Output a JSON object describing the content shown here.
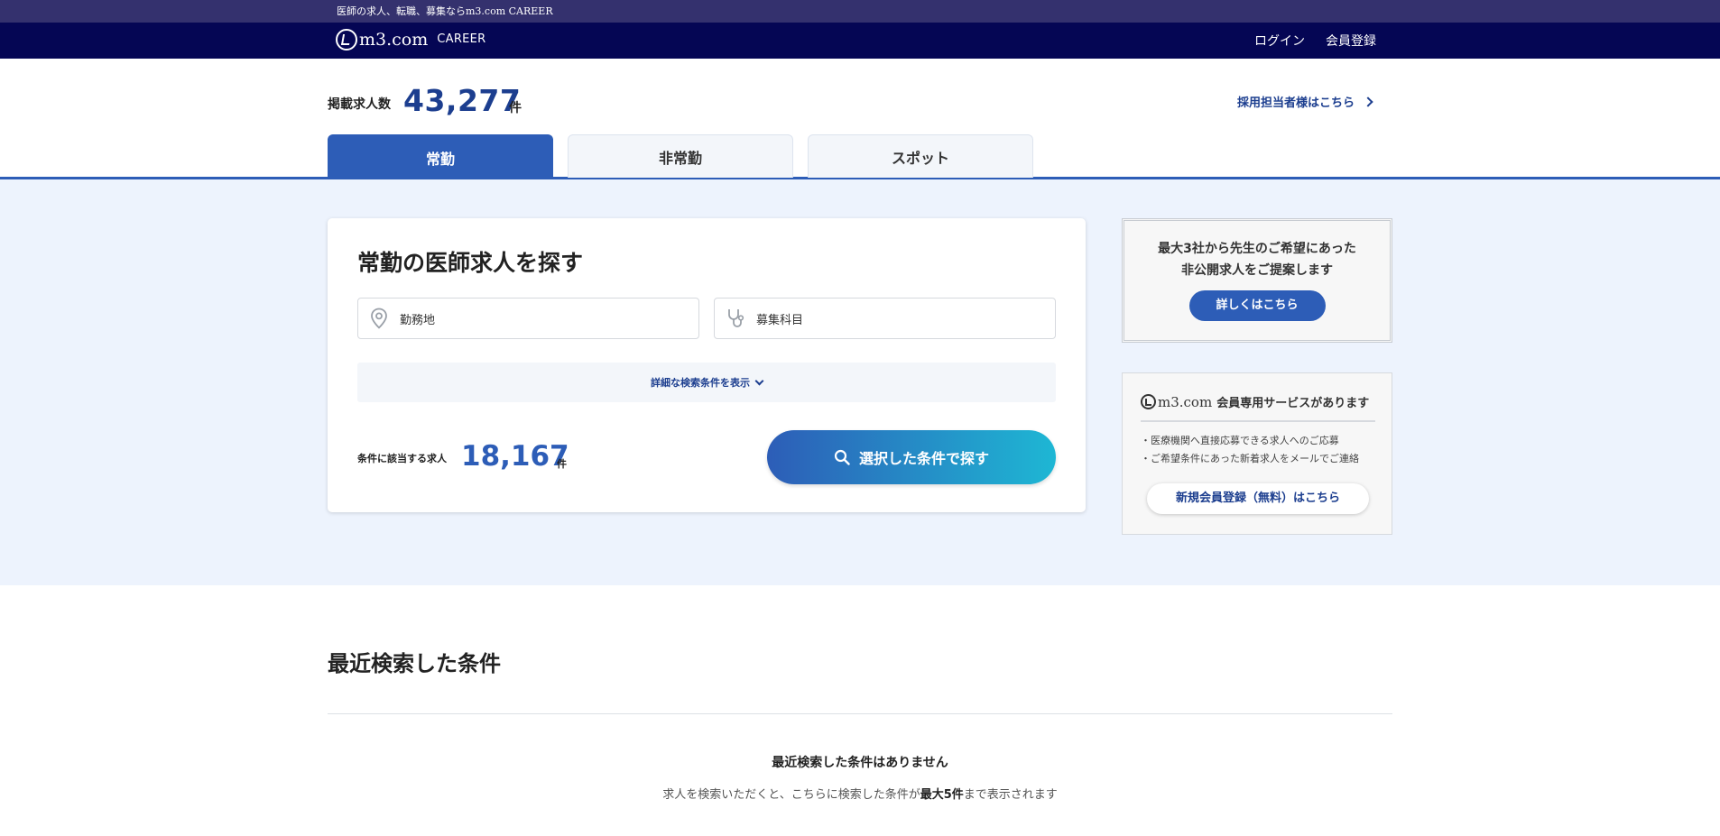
{
  "topline": {
    "text": "医師の求人、転職、募集ならm3.com CAREER"
  },
  "header": {
    "logo_m3": "m3.com",
    "logo_career": "CAREER",
    "login": "ログイン",
    "register": "会員登録"
  },
  "stats": {
    "label": "掲載求人数",
    "count": "43,277",
    "unit": "件",
    "recruiter_link": "採用担当者様はこちら"
  },
  "tabs": [
    {
      "label": "常勤",
      "active": true
    },
    {
      "label": "非常勤",
      "active": false
    },
    {
      "label": "スポット",
      "active": false
    }
  ],
  "search": {
    "title": "常勤の医師求人を探す",
    "location_field": "勤務地",
    "specialty_field": "募集科目",
    "detail_toggle": "詳細な検索条件を表示",
    "match_label": "条件に該当する求人",
    "match_count": "18,167",
    "match_unit": "件",
    "search_button": "選択した条件で探す"
  },
  "promo": {
    "line1": "最大3社から先生のご希望にあった",
    "line2": "非公開求人をご提案します",
    "button": "詳しくはこちら"
  },
  "member": {
    "logo_m3": "m3.com",
    "heading": "会員専用サービスがあります",
    "item1": "・医療機関へ直接応募できる求人へのご応募",
    "item2": "・ご希望条件にあった新着求人をメールでご連絡",
    "button": "新規会員登録（無料）はこちら"
  },
  "recent": {
    "title": "最近検索した条件",
    "empty": "最近検索した条件はありません",
    "desc_before": "求人を検索いただくと、こちらに検索した条件が",
    "desc_bold": "最大5件",
    "desc_after": "まで表示されます"
  },
  "colors": {
    "header_bg": "#050654",
    "topline_bg": "#34316e",
    "accent": "#2d5db7",
    "accent_dark": "#1c3e8f",
    "main_bg": "#edf3fd",
    "gradient_end": "#1eb7d4"
  },
  "icons": [
    "location-pin-icon",
    "stethoscope-icon",
    "search-icon",
    "chevron-right-icon",
    "chevron-down-icon"
  ]
}
